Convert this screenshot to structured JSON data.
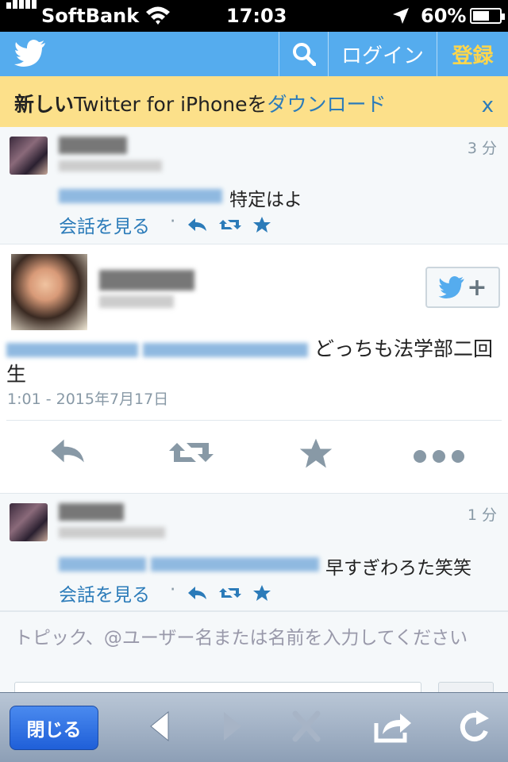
{
  "status_bar": {
    "carrier": "SoftBank",
    "time": "17:03",
    "battery": "60%",
    "battery_level": 0.6
  },
  "header": {
    "logo": "twitter-bird-icon",
    "search_icon": "search-icon",
    "login": "ログイン",
    "signup": "登録"
  },
  "banner": {
    "prefix": "新しい",
    "middle": "Twitter for iPhoneを",
    "link": "ダウンロード",
    "close": "x"
  },
  "tweets": [
    {
      "time_ago": "3 分",
      "text": "特定はよ",
      "conversation": "会話を見る",
      "separator": "·"
    },
    {
      "time_ago": "1 分",
      "text": "早すぎわろた笑笑",
      "conversation": "会話を見る",
      "separator": "·"
    }
  ],
  "main_tweet": {
    "text": "どっちも法学部二回生",
    "date": "1:01 - 2015年7月17日",
    "follow_plus": "+"
  },
  "search": {
    "placeholder": "トピック、@ユーザー名または名前を入力してください"
  },
  "toolbar": {
    "close_label": "閉じる",
    "icons": [
      "back-icon",
      "forward-icon",
      "stop-icon",
      "share-icon",
      "reload-icon"
    ]
  },
  "colors": {
    "twitter_blue": "#55acee",
    "link_blue": "#2b7bb9",
    "banner_yellow": "#fce08a",
    "signup_yellow": "#ffd64c"
  }
}
